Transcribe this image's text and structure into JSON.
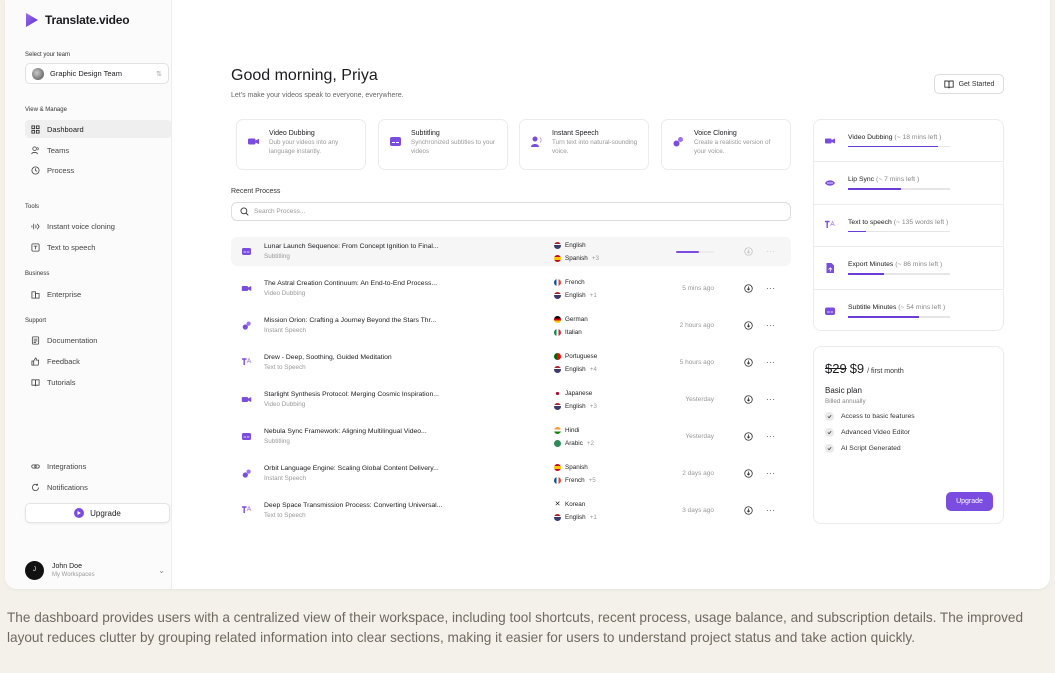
{
  "brand": {
    "name": "Translate.video",
    "accent": "#7b4ce0"
  },
  "sidebar": {
    "team_label": "Select your team",
    "team_name": "Graphic Design Team",
    "sections": {
      "view_manage": "View & Manage",
      "tools": "Tools",
      "business": "Business",
      "support": "Support"
    },
    "items": {
      "dashboard": "Dashboard",
      "teams": "Teams",
      "process": "Process",
      "instant_voice_cloning": "Instant voice cloning",
      "text_to_speech": "Text to speech",
      "enterprise": "Enterprise",
      "documentation": "Documentation",
      "feedback": "Feedback",
      "tutorials": "Tutorials",
      "integrations": "Integrations",
      "notifications": "Notifications"
    },
    "upgrade_label": "Upgrade",
    "user": {
      "initial": "J",
      "name": "John Doe",
      "sub": "My Workspaces"
    }
  },
  "header": {
    "greeting": "Good morning, Priya",
    "subtitle": "Let's make your videos speak to everyone, everywhere.",
    "get_started": "Get Started"
  },
  "tools": [
    {
      "title": "Video Dubbing",
      "desc": "Dub your videos into any language instantly."
    },
    {
      "title": "Subtitling",
      "desc": "Synchronized subtitles to your videos"
    },
    {
      "title": "Instant Speech",
      "desc": "Turn text into natural-sounding voice."
    },
    {
      "title": "Voice Cloning",
      "desc": "Create a realistic version of your voice."
    }
  ],
  "recent": {
    "title": "Recent Process",
    "search_placeholder": "Search Process...",
    "rows": [
      {
        "title": "Lunar Launch Sequence: From Concept Ignition to Final...",
        "type": "Subtitling",
        "lang1": "English",
        "lang2": "Spanish",
        "extra": "+3",
        "time": "",
        "progress": 0.6
      },
      {
        "title": "The Astral Creation Continuum: An End-to-End Process...",
        "type": "Video Dubbing",
        "lang1": "French",
        "lang2": "English",
        "extra": "+1",
        "time": "5 mins ago"
      },
      {
        "title": "Mission Orion: Crafting a Journey Beyond the Stars Thr...",
        "type": "Instant Speech",
        "lang1": "German",
        "lang2": "Italian",
        "extra": "",
        "time": "2 hours ago"
      },
      {
        "title": "Drew - Deep, Soothing, Guided Meditation",
        "type": "Text to Speech",
        "lang1": "Portuguese",
        "lang2": "English",
        "extra": "+4",
        "time": "5 hours ago"
      },
      {
        "title": "Starlight Synthesis Protocol: Merging Cosmic Inspiration...",
        "type": "Video Dubbing",
        "lang1": "Japanese",
        "lang2": "English",
        "extra": "+3",
        "time": "Yesterday"
      },
      {
        "title": "Nebula Sync Framework: Aligning Multilingual Video...",
        "type": "Subtitling",
        "lang1": "Hindi",
        "lang2": "Arabic",
        "extra": "+2",
        "time": "Yesterday"
      },
      {
        "title": "Orbit Language Engine: Scaling Global Content Delivery...",
        "type": "Instant Speech",
        "lang1": "Spanish",
        "lang2": "French",
        "extra": "+5",
        "time": "2 days ago"
      },
      {
        "title": "Deep Space Transmission Process: Converting Universal...",
        "type": "Text to Speech",
        "lang1": "Korean",
        "lang2": "English",
        "extra": "+1",
        "time": "3 days ago"
      }
    ]
  },
  "usage": [
    {
      "name": "Video Dubbing",
      "left": "(~ 18 mins left )",
      "fill": 0.88
    },
    {
      "name": "Lip Sync",
      "left": "(~ 7 mins left )",
      "fill": 0.52
    },
    {
      "name": "Text to speech",
      "left": "(~ 135 words left )",
      "fill": 0.18
    },
    {
      "name": "Export Minutes",
      "left": "(~ 86 mins left )",
      "fill": 0.35
    },
    {
      "name": "Subtitle Minutes",
      "left": "(~ 54 mins left )",
      "fill": 0.7
    }
  ],
  "plan": {
    "old_price": "$29",
    "new_price": "$9",
    "per": "/ first month",
    "name": "Basic plan",
    "billed": "Billed annually",
    "features": [
      "Access to basic features",
      "Advanced Video Editor",
      "AI Script Generated"
    ],
    "upgrade": "Upgrade"
  },
  "caption": "The dashboard provides users with a centralized view of their workspace, including tool shortcuts, recent process, usage balance, and subscription details. The improved layout reduces clutter by grouping related information into clear sections, making it easier for users to understand project status and take action quickly."
}
